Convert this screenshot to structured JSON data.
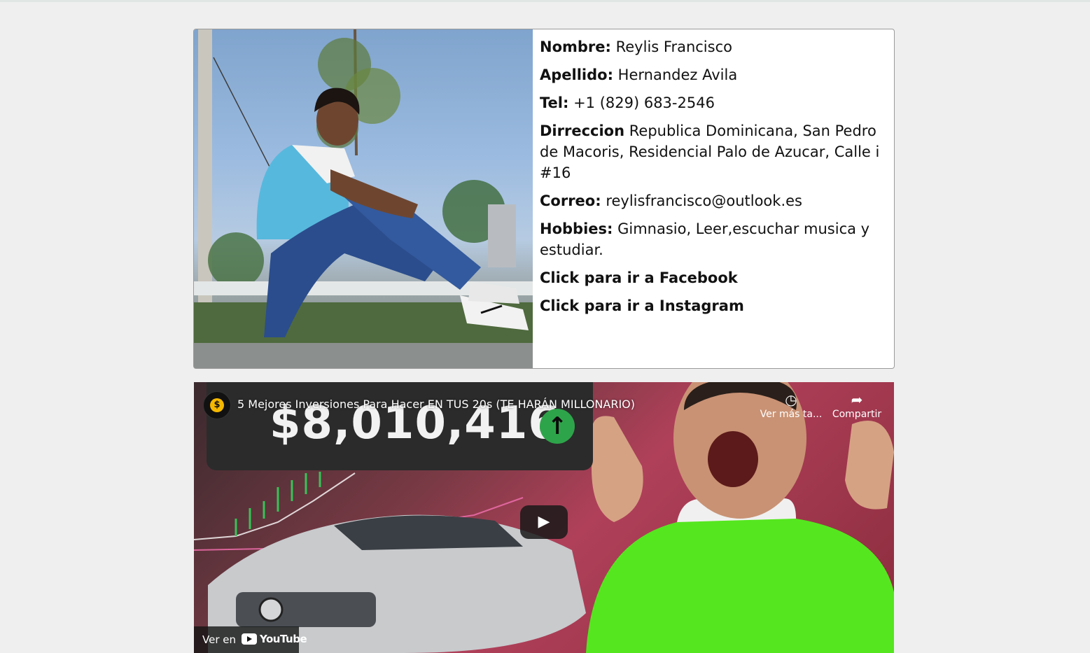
{
  "profile": {
    "nombre_label": "Nombre:",
    "nombre": "Reylis Francisco",
    "apellido_label": "Apellido:",
    "apellido": "Hernandez Avila",
    "tel_label": "Tel:",
    "tel": "+1 (829) 683-2546",
    "direccion_label": "Dirreccion",
    "direccion": "Republica Dominicana, San Pedro de Macoris, Residencial Palo de Azucar, Calle i #16",
    "correo_label": "Correo:",
    "correo": "reylisfrancisco@outlook.es",
    "hobbies_label": "Hobbies:",
    "hobbies": "Gimnasio, Leer,escuchar musica y estudiar.",
    "facebook_link": "Click para ir a Facebook",
    "instagram_link": "Click para ir a Instagram"
  },
  "video": {
    "title": "5 Mejores Inversiones Para Hacer EN TUS 20s (TE HARÁN MILLONARIO)",
    "channel_logo_glyph": "$",
    "big_number": "$8,010,416",
    "arrow_glyph": "↑",
    "watch_later": "Ver más ta...",
    "share": "Compartir",
    "watch_on": "Ver en",
    "youtube": "YouTube"
  }
}
